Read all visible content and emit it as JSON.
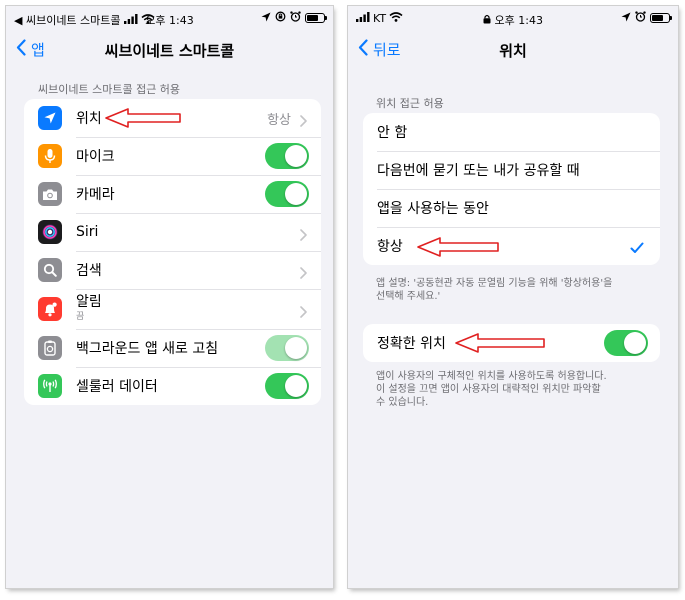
{
  "left": {
    "status": {
      "back_app": "◀ 씨브이네트 스마트콜",
      "time": "오후 1:43"
    },
    "nav": {
      "back_label": "앱",
      "title": "씨브이네트 스마트콜"
    },
    "section_header": "씨브이네트 스마트콜 접근 허용",
    "rows": [
      {
        "label": "위치",
        "value": "항상",
        "accessory": "chevron",
        "icon": "location-arrow-icon",
        "icon_color": "#0a7aff"
      },
      {
        "label": "마이크",
        "accessory": "toggle-on",
        "icon": "microphone-icon",
        "icon_color": "#ff9500"
      },
      {
        "label": "카메라",
        "accessory": "toggle-on",
        "icon": "camera-icon",
        "icon_color": "#8e8e93"
      },
      {
        "label": "Siri",
        "accessory": "chevron",
        "icon": "siri-icon",
        "icon_color": "#1c1c1e"
      },
      {
        "label": "검색",
        "accessory": "chevron",
        "icon": "search-icon",
        "icon_color": "#8e8e93"
      },
      {
        "label": "알림",
        "sublabel": "끔",
        "accessory": "chevron",
        "icon": "bell-icon",
        "icon_color": "#ff3b30"
      },
      {
        "label": "백그라운드 앱 새로 고침",
        "accessory": "toggle-on-dimmed",
        "icon": "refresh-gear-icon",
        "icon_color": "#8e8e93"
      },
      {
        "label": "셀룰러 데이터",
        "accessory": "toggle-on",
        "icon": "cellular-antenna-icon",
        "icon_color": "#34c759"
      }
    ]
  },
  "right": {
    "status": {
      "carrier": "KT",
      "time": "오후 1:43"
    },
    "nav": {
      "back_label": "뒤로",
      "title": "위치"
    },
    "section_header": "위치 접근 허용",
    "options": [
      {
        "label": "안 함",
        "selected": false
      },
      {
        "label": "다음번에 묻기 또는 내가 공유할 때",
        "selected": false
      },
      {
        "label": "앱을 사용하는 동안",
        "selected": false
      },
      {
        "label": "항상",
        "selected": true
      }
    ],
    "app_note": [
      "앱 설명: '공동현관 자동 문열림 기능을 위해 '항상허용'을",
      "선택해 주세요.'"
    ],
    "precise": {
      "label": "정확한 위치",
      "on": true
    },
    "precise_note": [
      "앱이 사용자의 구체적인 위치를 사용하도록 허용합니다.",
      "이 설정을 끄면 앱이 사용자의 대략적인 위치만 파악할",
      "수 있습니다."
    ]
  },
  "colors": {
    "accent": "#0a7aff",
    "toggle_on": "#34c759",
    "annotation_arrow": "#e02020"
  }
}
